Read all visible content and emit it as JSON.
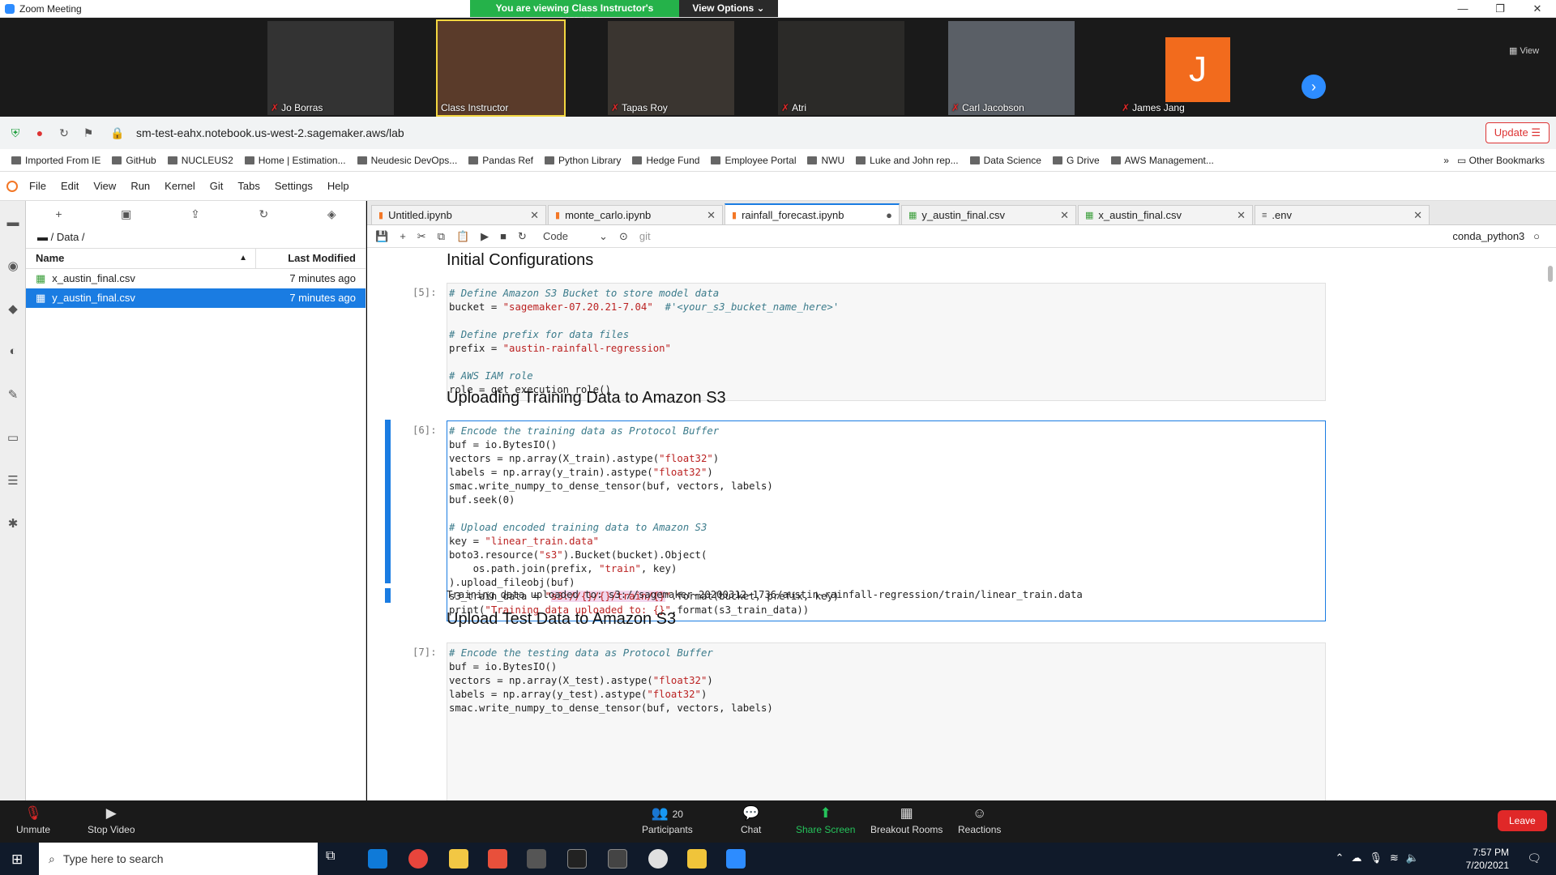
{
  "zoom": {
    "app_title": "Zoom Meeting",
    "viewing_banner": "You are viewing Class Instructor's screen",
    "view_options": "View Options",
    "view_label": "View",
    "participants_gallery": [
      {
        "name": "Jo Borras",
        "muted": true
      },
      {
        "name": "Class Instructor",
        "muted": false
      },
      {
        "name": "Tapas Roy",
        "muted": true
      },
      {
        "name": "Atri",
        "muted": true
      },
      {
        "name": "Carl Jacobson",
        "muted": true
      },
      {
        "name": "James Jang",
        "muted": true,
        "initial": "J"
      }
    ],
    "controls": {
      "unmute": "Unmute",
      "stop_video": "Stop Video",
      "participants": "Participants",
      "participants_count": "20",
      "chat": "Chat",
      "share_screen": "Share Screen",
      "breakout_rooms": "Breakout Rooms",
      "reactions": "Reactions",
      "leave": "Leave"
    }
  },
  "browser": {
    "url": "sm-test-eahx.notebook.us-west-2.sagemaker.aws/lab",
    "update_label": "Update",
    "bookmarks": [
      "Imported From IE",
      "GitHub",
      "NUCLEUS2",
      "Home | Estimation...",
      "Neudesic DevOps...",
      "Pandas Ref",
      "Python Library",
      "Hedge Fund",
      "Employee Portal",
      "NWU",
      "Luke and John rep...",
      "Data Science",
      "G Drive",
      "AWS Management..."
    ],
    "other_bookmarks": "Other Bookmarks"
  },
  "jupyter": {
    "menu": [
      "File",
      "Edit",
      "View",
      "Run",
      "Kernel",
      "Git",
      "Tabs",
      "Settings",
      "Help"
    ],
    "file_browser": {
      "path": "/ Data /",
      "col_name": "Name",
      "col_modified": "Last Modified",
      "files": [
        {
          "name": "x_austin_final.csv",
          "modified": "7 minutes ago"
        },
        {
          "name": "y_austin_final.csv",
          "modified": "7 minutes ago"
        }
      ]
    },
    "tabs": [
      {
        "label": "Untitled.ipynb",
        "type": "nb"
      },
      {
        "label": "monte_carlo.ipynb",
        "type": "nb"
      },
      {
        "label": "rainfall_forecast.ipynb",
        "type": "nb"
      },
      {
        "label": "y_austin_final.csv",
        "type": "csv"
      },
      {
        "label": "x_austin_final.csv",
        "type": "csv"
      },
      {
        "label": ".env",
        "type": "txt"
      }
    ],
    "toolbar": {
      "cell_type": "Code",
      "git": "git",
      "kernel": "conda_python3"
    },
    "headings": {
      "h1": "Initial Configurations",
      "h2": "Uploading Training Data to Amazon S3",
      "h3": "Upload Test Data to Amazon S3"
    },
    "prompts": {
      "p5": "[5]:",
      "p6": "[6]:",
      "p7": "[7]:"
    },
    "output_text": "Training data uploaded to: s3://sagemaker-20200312-1736/austin-rainfall-regression/train/linear_train.data"
  },
  "taskbar": {
    "search_placeholder": "Type here to search",
    "time": "7:57 PM",
    "date": "7/20/2021"
  },
  "colors": {
    "accent": "#1a7ce2",
    "zoom_green": "#25b24a",
    "leave_red": "#e02828",
    "avatar_orange": "#f26b1d"
  }
}
